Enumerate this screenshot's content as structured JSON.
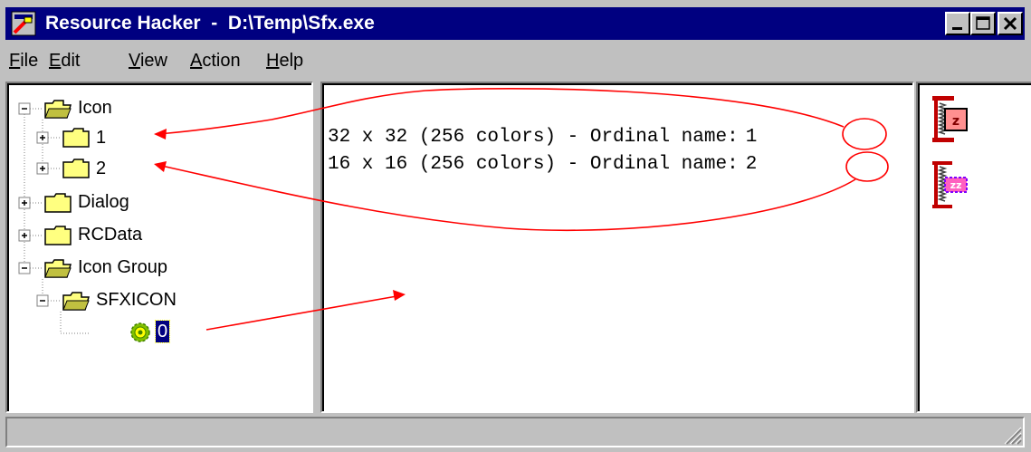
{
  "window": {
    "title": "Resource Hacker  -  D:\\Temp\\Sfx.exe"
  },
  "menu": [
    {
      "label": "File",
      "mnemonic": "F",
      "rest": "ile"
    },
    {
      "label": "Edit",
      "mnemonic": "E",
      "rest": "dit"
    },
    {
      "label": "View",
      "mnemonic": "V",
      "rest": "iew"
    },
    {
      "label": "Action",
      "mnemonic": "A",
      "rest": "ction"
    },
    {
      "label": "Help",
      "mnemonic": "H",
      "rest": "elp"
    }
  ],
  "tree": {
    "items": [
      {
        "label": "Icon",
        "state": "expanded",
        "icon": "open-folder-icon"
      },
      {
        "label": "1",
        "state": "collapsed",
        "icon": "folder-icon"
      },
      {
        "label": "2",
        "state": "collapsed",
        "icon": "folder-icon"
      },
      {
        "label": "Dialog",
        "state": "collapsed",
        "icon": "folder-icon"
      },
      {
        "label": "RCData",
        "state": "collapsed",
        "icon": "folder-icon"
      },
      {
        "label": "Icon Group",
        "state": "expanded",
        "icon": "open-folder-icon"
      },
      {
        "label": "SFXICON",
        "state": "expanded",
        "icon": "open-folder-icon"
      },
      {
        "label": "0",
        "state": "selected",
        "icon": "resource-gear-icon"
      }
    ]
  },
  "resource_view": {
    "lines": [
      {
        "text": "32 x 32 (256 colors) - Ordinal name:",
        "ordinal": "1"
      },
      {
        "text": "16 x 16 (256 colors) - Ordinal name:",
        "ordinal": "2"
      }
    ]
  },
  "preview": {
    "icons": [
      "large-compress-icon",
      "small-compress-icon"
    ]
  },
  "statusbar": {
    "text": ""
  },
  "colors": {
    "titlebar": "#000080",
    "face": "#c0c0c0",
    "annotation": "#ff0000",
    "folder": "#ffff80"
  }
}
